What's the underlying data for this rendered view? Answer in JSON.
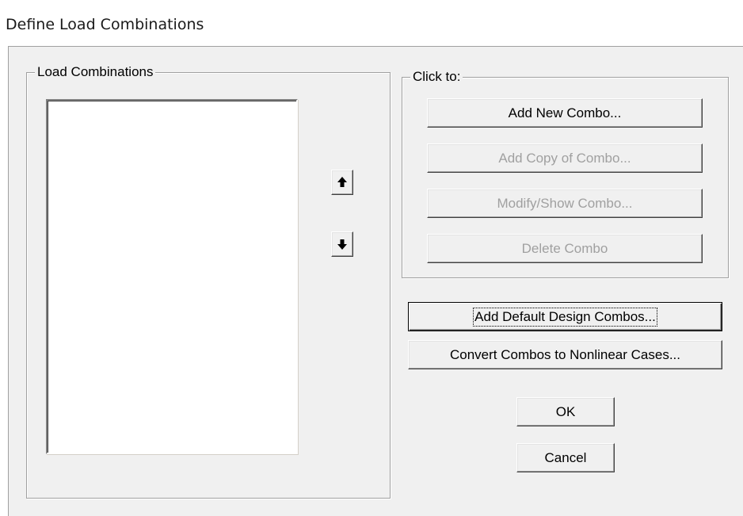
{
  "window": {
    "title": "Define Load Combinations"
  },
  "load_combinations": {
    "group_label": "Load Combinations",
    "items": []
  },
  "reorder": {
    "up_icon": "arrow-up-icon",
    "down_icon": "arrow-down-icon"
  },
  "click_to": {
    "group_label": "Click to:",
    "add_new_combo": "Add New Combo...",
    "add_copy_of_combo": "Add Copy of Combo...",
    "modify_show_combo": "Modify/Show Combo...",
    "delete_combo": "Delete Combo"
  },
  "actions": {
    "add_default_design_combos": "Add Default Design Combos...",
    "convert_combos": "Convert Combos to Nonlinear Cases...",
    "ok": "OK",
    "cancel": "Cancel"
  },
  "colors": {
    "dialog_background": "#f0f0f0",
    "disabled_text": "#a0a0a0"
  }
}
